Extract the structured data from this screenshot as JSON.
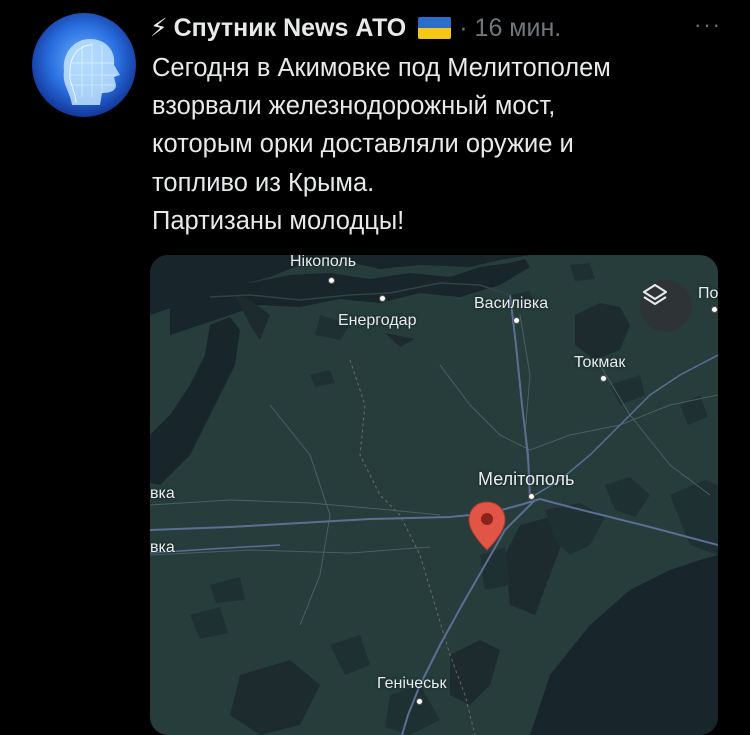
{
  "tweet": {
    "author": "Спутник News АТО",
    "time": "· 16 мин.",
    "more": "···",
    "lines": [
      "Сегодня в Акимовке под Мелитополем",
      "взорвали железнодорожный мост,",
      "которым орки доставляли оружие и",
      "топливо из Крыма.",
      "Партизаны молодцы!"
    ]
  },
  "map": {
    "labels": {
      "nikopol": "Нікополь",
      "enerhodar": "Енергодар",
      "vasylivka": "Василівка",
      "tokmak": "Токмак",
      "melitopol": "Мелітополь",
      "henichesk": "Генічеськ",
      "pol": "Пол",
      "vka1": "вка",
      "vka2": "вка"
    },
    "colors": {
      "land": "#263d3c",
      "water": "#18252a",
      "road": "#5b6f95",
      "pin": "#e05545"
    }
  }
}
